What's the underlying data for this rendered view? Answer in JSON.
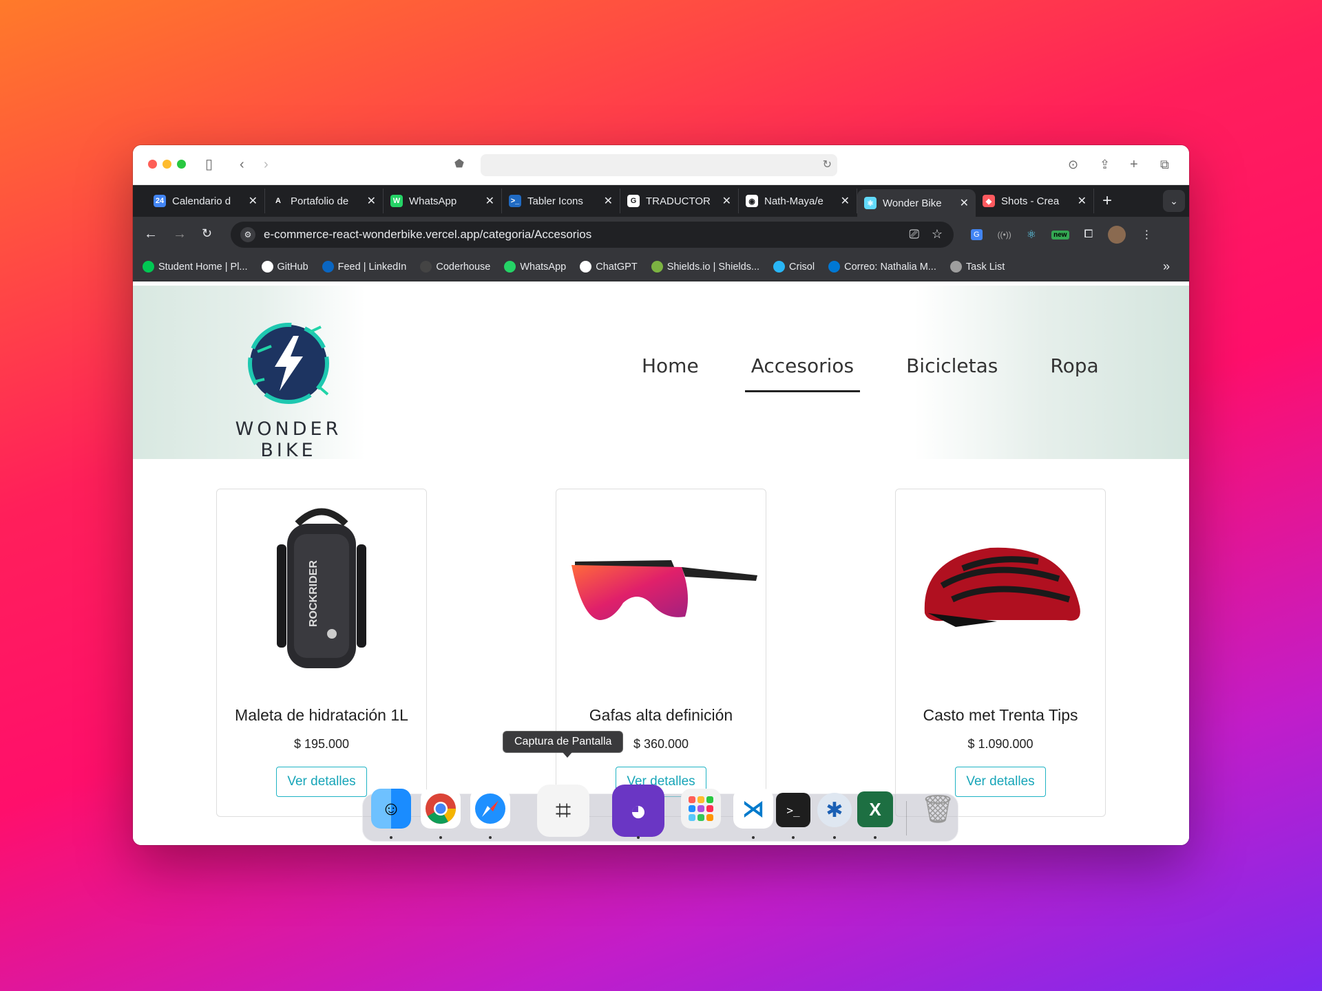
{
  "browser": {
    "tabs": [
      {
        "label": "Calendario d",
        "icon": "google-calendar-icon",
        "color": "#4285f4",
        "glyph": "24"
      },
      {
        "label": "Portafolio de",
        "icon": "behance-icon",
        "color": "#1f2023",
        "glyph": "A"
      },
      {
        "label": "WhatsApp",
        "icon": "whatsapp-icon",
        "color": "#25d366",
        "glyph": "W"
      },
      {
        "label": "Tabler Icons",
        "icon": "tabler-icon",
        "color": "#206bc4",
        "glyph": ">_"
      },
      {
        "label": "TRADUCTOR",
        "icon": "google-icon",
        "color": "#ffffff",
        "glyph": "G"
      },
      {
        "label": "Nath-Maya/e",
        "icon": "github-icon",
        "color": "#ffffff",
        "glyph": "◉"
      },
      {
        "label": "Wonder Bike",
        "icon": "react-icon",
        "color": "#61dafb",
        "glyph": "⚛"
      },
      {
        "label": "Shots - Crea",
        "icon": "shots-icon",
        "color": "#ff5a5f",
        "glyph": "◆"
      }
    ],
    "url": "e-commerce-react-wonderbike.vercel.app/categoria/Accesorios",
    "bookmarks": [
      {
        "label": "Student Home | Pl...",
        "color": "#00c853"
      },
      {
        "label": "GitHub",
        "color": "#ffffff"
      },
      {
        "label": "Feed | LinkedIn",
        "color": "#0a66c2"
      },
      {
        "label": "Coderhouse",
        "color": "#444444"
      },
      {
        "label": "WhatsApp",
        "color": "#25d366"
      },
      {
        "label": "ChatGPT",
        "color": "#ffffff"
      },
      {
        "label": "Shields.io | Shields...",
        "color": "#7cb342"
      },
      {
        "label": "Crisol",
        "color": "#29b6f6"
      },
      {
        "label": "Correo: Nathalia M...",
        "color": "#0078d4"
      },
      {
        "label": "Task List",
        "color": "#9e9e9e"
      }
    ],
    "ext_new_badge": "new"
  },
  "site": {
    "brand": "WONDER BIKE",
    "nav": [
      "Home",
      "Accesorios",
      "Bicicletas",
      "Ropa"
    ],
    "active_nav": "Accesorios",
    "products": [
      {
        "name": "Maleta de hidratación 1L",
        "price": "$ 195.000",
        "button": "Ver detalles"
      },
      {
        "name": "Gafas alta definición",
        "price": "$ 360.000",
        "button": "Ver detalles"
      },
      {
        "name": "Casto met Trenta Tips",
        "price": "$ 1.090.000",
        "button": "Ver detalles"
      }
    ]
  },
  "dock": {
    "tooltip": "Captura de Pantalla",
    "apps": [
      "finder",
      "chrome",
      "safari",
      "screenshot",
      "github-desktop",
      "launchpad",
      "vscode",
      "terminal",
      "disk-utility",
      "excel",
      "trash"
    ]
  }
}
